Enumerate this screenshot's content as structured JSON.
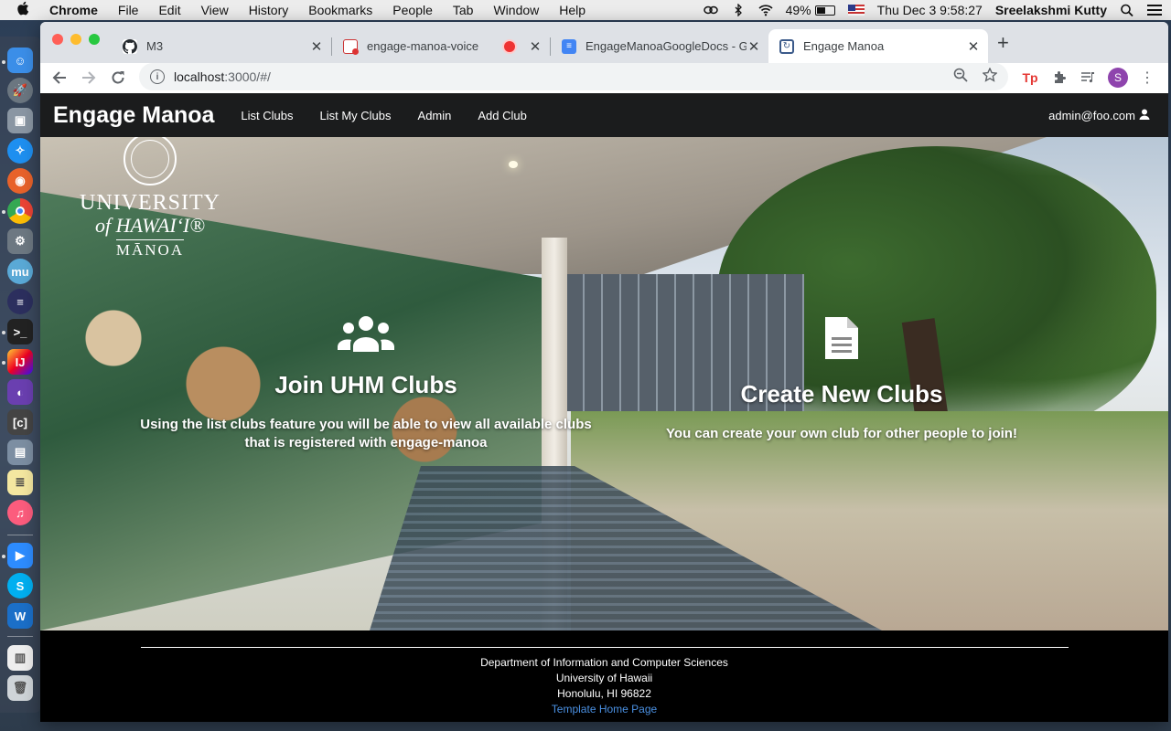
{
  "menubar": {
    "app_name": "Chrome",
    "menus": [
      "File",
      "Edit",
      "View",
      "History",
      "Bookmarks",
      "People",
      "Tab",
      "Window",
      "Help"
    ],
    "battery_percent": "49%",
    "datetime": "Thu Dec 3  9:58:27",
    "user": "Sreelakshmi Kutty"
  },
  "browser": {
    "tabs": [
      {
        "title": "M3",
        "icon": "github-icon"
      },
      {
        "title": "engage-manoa-voice",
        "icon": "recording-icon"
      },
      {
        "title": "EngageManoaGoogleDocs - Go",
        "icon": "google-docs-icon"
      },
      {
        "title": "Engage Manoa",
        "icon": "app-favicon",
        "active": true
      }
    ],
    "url_host": "localhost",
    "url_path": ":3000/#/",
    "profile_initial": "S"
  },
  "app": {
    "brand": "Engage Manoa",
    "nav_links": [
      "List Clubs",
      "List My Clubs",
      "Admin",
      "Add Club"
    ],
    "user_email": "admin@foo.com"
  },
  "hero": {
    "logo": {
      "line1": "UNIVERSITY",
      "line2": "of HAWAIʻI®",
      "line3": "MĀNOA"
    },
    "features": [
      {
        "icon": "users-icon",
        "title": "Join UHM Clubs",
        "description_line1": "Using the list clubs feature you will be able to view all available clubs",
        "description_line2": "that is registered with engage-manoa"
      },
      {
        "icon": "file-text-icon",
        "title": "Create New Clubs",
        "description_line1": "You can create your own club for other people to join!",
        "description_line2": ""
      }
    ]
  },
  "footer": {
    "line1": "Department of Information and Computer Sciences",
    "line2": "University of Hawaii",
    "line3": "Honolulu, HI 96822",
    "link": "Template Home Page"
  },
  "colors": {
    "navbar_bg": "#1b1c1d",
    "footer_bg": "#000000",
    "link": "#4a90e2"
  }
}
